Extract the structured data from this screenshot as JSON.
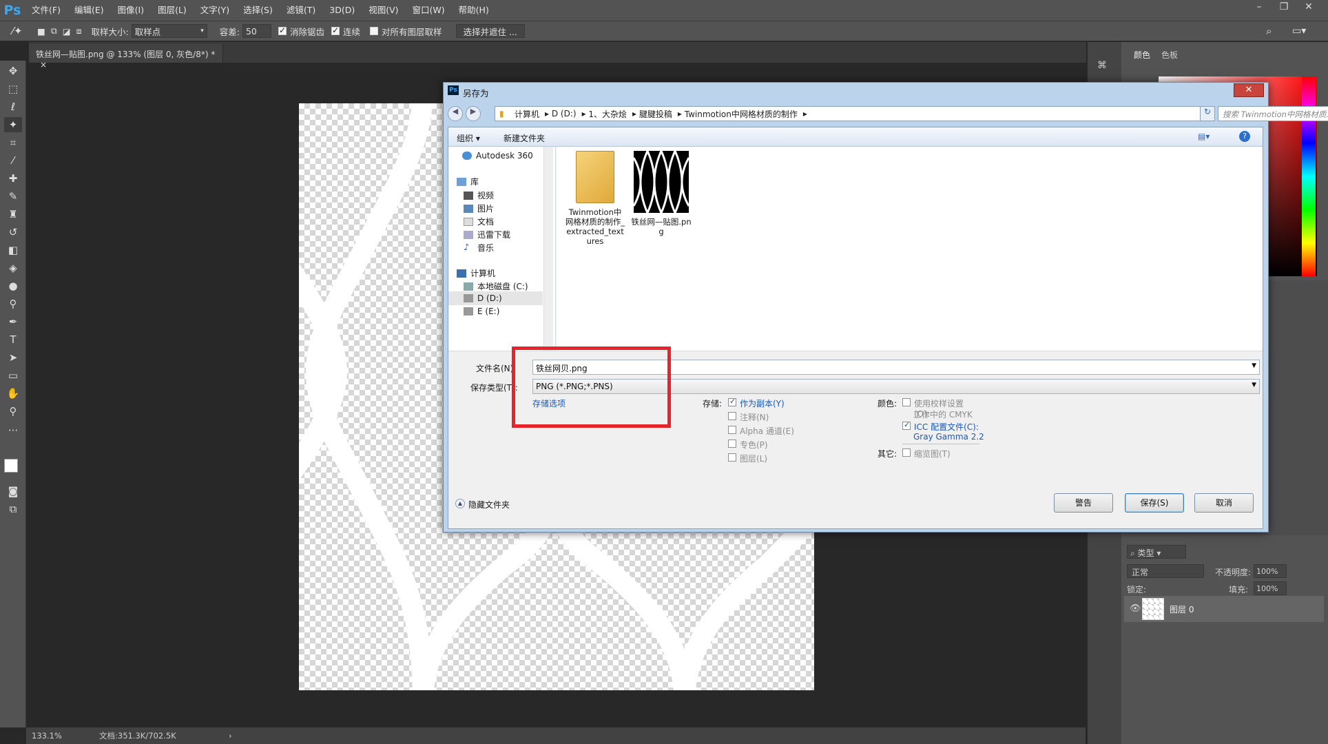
{
  "app": {
    "logo": "Ps"
  },
  "menu": [
    "文件(F)",
    "编辑(E)",
    "图像(I)",
    "图层(L)",
    "文字(Y)",
    "选择(S)",
    "滤镜(T)",
    "3D(D)",
    "视图(V)",
    "窗口(W)",
    "帮助(H)"
  ],
  "options": {
    "sample_size_label": "取样大小:",
    "sample_size_value": "取样点",
    "tolerance_label": "容差:",
    "tolerance_value": "50",
    "antialias": "消除锯齿",
    "contiguous": "连续",
    "sample_all": "对所有图层取样",
    "select_mask": "选择并遮住 ..."
  },
  "document": {
    "tab_title": "铁丝网—贴图.png @ 133% (图层 0, 灰色/8*) *",
    "tab_close": "×"
  },
  "status": {
    "zoom": "133.1%",
    "doc_info": "文档:351.3K/702.5K",
    "arrow": "›"
  },
  "right_panel": {
    "tab_color": "颜色",
    "tab_swatches": "色板",
    "layers_filter": "类型",
    "blend_mode": "正常",
    "opacity_label": "不透明度:",
    "opacity_value": "100%",
    "lock_label": "锁定:",
    "fill_label": "填充:",
    "fill_value": "100%",
    "layer_name": "图层 0"
  },
  "dialog": {
    "title": "另存为",
    "breadcrumb": [
      "计算机",
      "D (D:)",
      "1、大杂烩",
      "腱腱投稿",
      "Twinmotion中网格材质的制作"
    ],
    "search_placeholder": "搜索 Twinmotion中网格材质...",
    "organize": "组织 ▾",
    "new_folder": "新建文件夹",
    "help": "?",
    "nav": {
      "autodesk": "Autodesk 360",
      "library": "库",
      "videos": "视频",
      "pictures": "图片",
      "documents": "文档",
      "thunder": "迅雷下载",
      "music": "音乐",
      "computer": "计算机",
      "drive_c": "本地磁盘 (C:)",
      "drive_d": "D (D:)",
      "drive_e": "E (E:)"
    },
    "files": [
      {
        "name": "Twinmotion中网格材质的制作_extracted_textures",
        "icon": "folder-icon"
      },
      {
        "name": "铁丝网—贴图.png",
        "icon": "image-thumbnail"
      }
    ],
    "filename_label": "文件名(N):",
    "filename_value": "铁丝网贝.png",
    "filetype_label": "保存类型(T):",
    "filetype_value": "PNG (*.PNG;*.PNS)",
    "save_options_link": "存储选项",
    "store_label": "存储:",
    "as_copy": "作为副本(Y)",
    "notes": "注释(N)",
    "alpha": "Alpha 通道(E)",
    "spot": "专色(P)",
    "layers": "图层(L)",
    "color_label": "颜色:",
    "use_proof": "使用校样设置(O):",
    "proof_value": "工作中的 CMYK",
    "icc": "ICC 配置文件(C):",
    "icc_value": "Gray Gamma 2.2",
    "other_label": "其它:",
    "thumbnail": "缩览图(T)",
    "hide_folders": "隐藏文件夹",
    "warning_btn": "警告",
    "save_btn": "保存(S)",
    "cancel_btn": "取消"
  }
}
